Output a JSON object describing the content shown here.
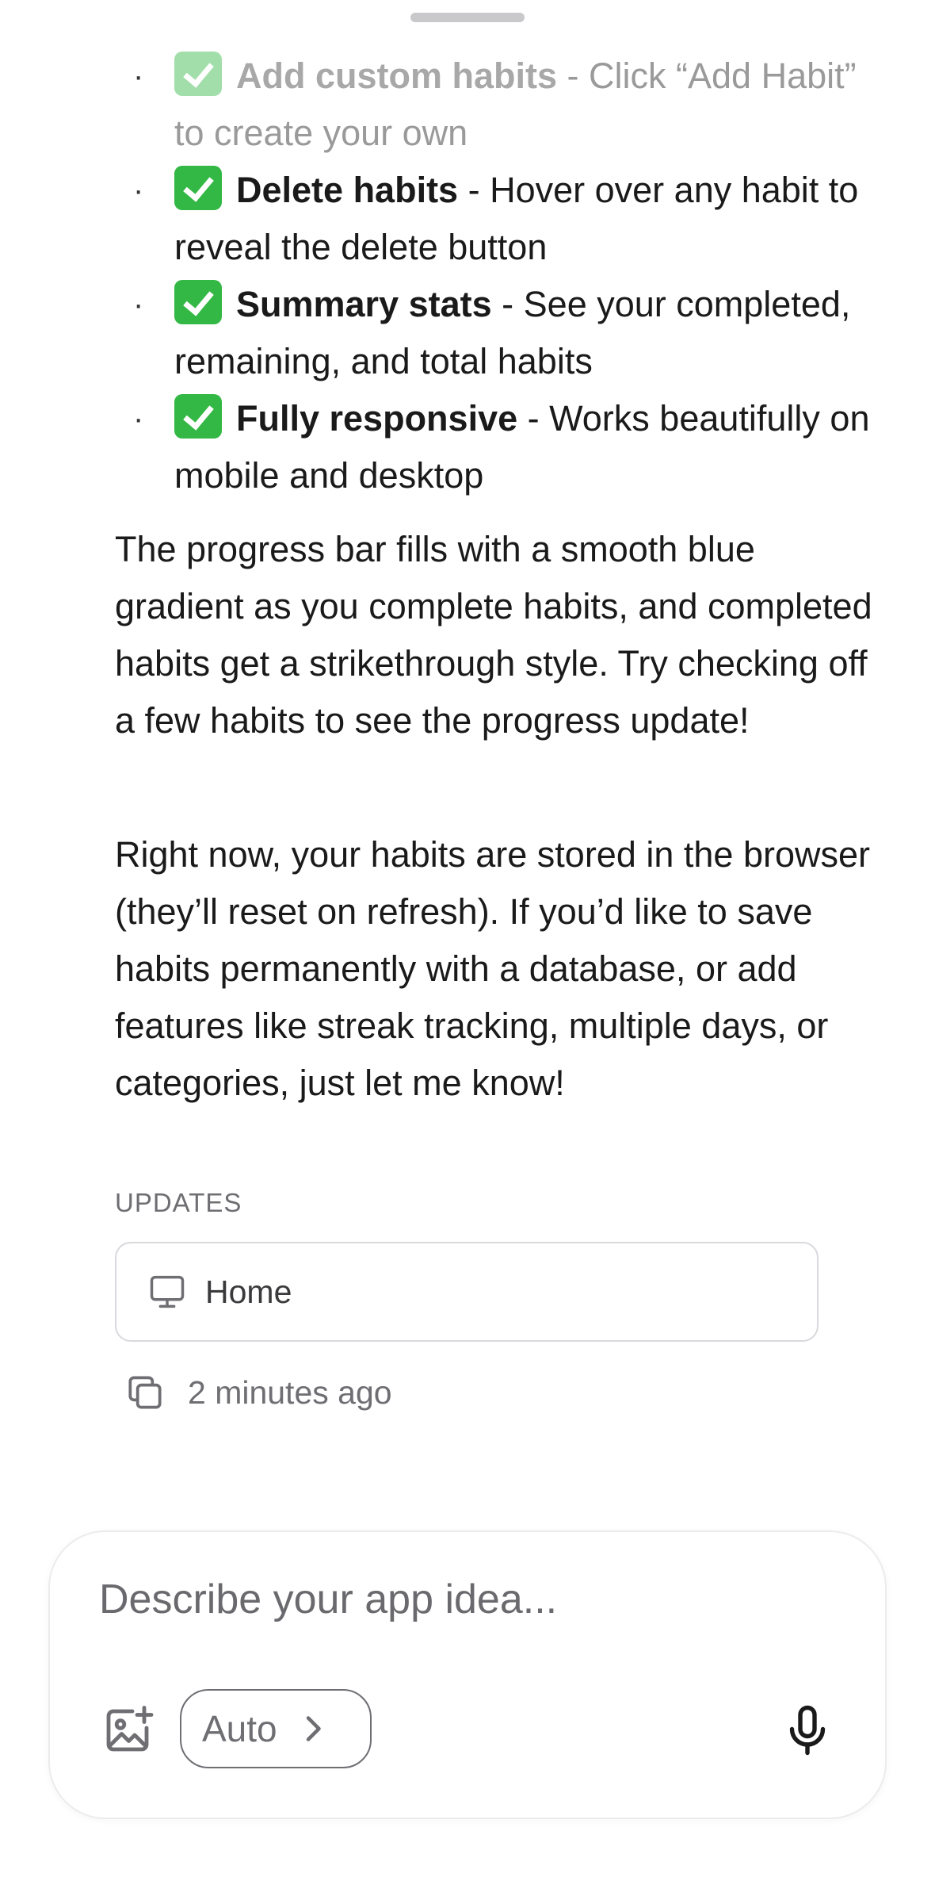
{
  "features": [
    {
      "title": "Add custom habits",
      "desc": " - Click “Add Habit” to create your own",
      "faded": true
    },
    {
      "title": "Delete habits",
      "desc": " - Hover over any habit to reveal the delete button",
      "faded": false
    },
    {
      "title": "Summary stats",
      "desc": " - See your completed, remaining, and total habits",
      "faded": false
    },
    {
      "title": "Fully responsive",
      "desc": " - Works beautifully on mobile and desktop",
      "faded": false
    }
  ],
  "paragraphs": {
    "progress": "The progress bar fills with a smooth blue gradient as you complete habits, and completed habits get a strikethrough style. Try checking off a few habits to see the progress update!",
    "storage": "Right now, your habits are stored in the browser (they’ll reset on refresh). If you’d like to save habits permanently with a database, or add features like streak tracking, multiple days, or categories, just let me know!"
  },
  "updates": {
    "label": "UPDATES",
    "card_label": "Home",
    "timestamp": "2 minutes ago"
  },
  "composer": {
    "placeholder": "Describe your app idea...",
    "mode_label": "Auto"
  },
  "icons": {
    "bullet_check": "check-emoji-icon",
    "card": "monitor-icon",
    "copy": "copy-icon",
    "image_add": "image-add-icon",
    "chevron": "chevron-right-icon",
    "mic": "microphone-icon"
  },
  "colors": {
    "check_green": "#33b845",
    "muted_text": "#6e6e73",
    "border": "#d9d9de"
  }
}
